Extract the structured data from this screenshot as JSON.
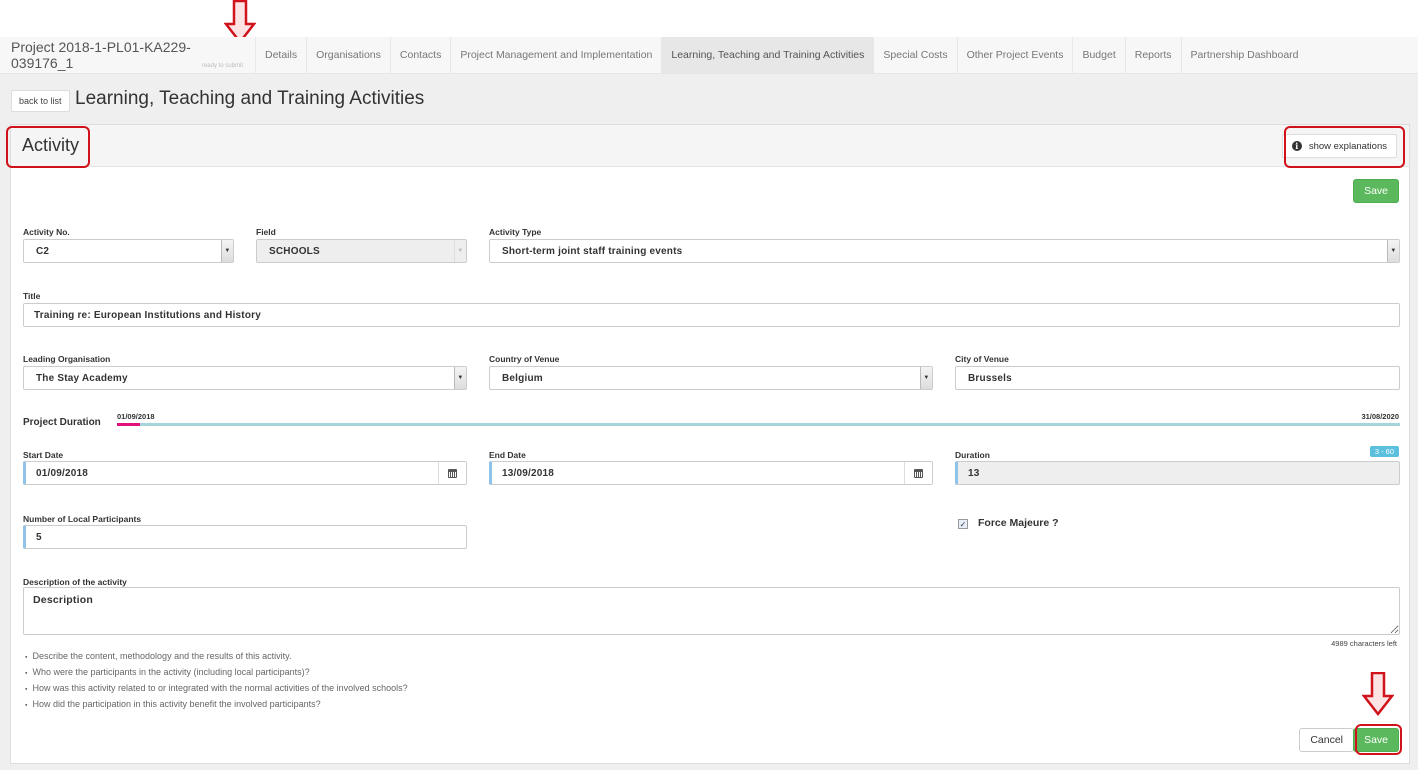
{
  "navbar": {
    "project_title": "Project 2018-1-PL01-KA229-039176_1",
    "project_status": "ready to submit",
    "tabs": [
      {
        "label": "Details",
        "active": false
      },
      {
        "label": "Organisations",
        "active": false
      },
      {
        "label": "Contacts",
        "active": false
      },
      {
        "label": "Project Management and Implementation",
        "active": false
      },
      {
        "label": "Learning, Teaching and Training Activities",
        "active": true
      },
      {
        "label": "Special Costs",
        "active": false
      },
      {
        "label": "Other Project Events",
        "active": false
      },
      {
        "label": "Budget",
        "active": false
      },
      {
        "label": "Reports",
        "active": false
      },
      {
        "label": "Partnership Dashboard",
        "active": false
      }
    ]
  },
  "header": {
    "back_label": "back to list",
    "title": "Learning, Teaching and Training Activities"
  },
  "panel": {
    "title": "Activity",
    "explain_label": "show explanations",
    "save_label": "Save",
    "cancel_label": "Cancel"
  },
  "form": {
    "activity_no": {
      "label": "Activity No.",
      "value": "C2"
    },
    "field": {
      "label": "Field",
      "value": "SCHOOLS"
    },
    "activity_type": {
      "label": "Activity Type",
      "value": "Short-term joint staff training events"
    },
    "title": {
      "label": "Title",
      "value": "Training re: European Institutions and History"
    },
    "leading_org": {
      "label": "Leading Organisation",
      "value": "The Stay Academy"
    },
    "country": {
      "label": "Country of Venue",
      "value": "Belgium"
    },
    "city": {
      "label": "City of Venue",
      "value": "Brussels"
    },
    "project_duration": {
      "label": "Project Duration",
      "start": "01/09/2018",
      "end": "31/08/2020",
      "activity_fraction": 0.018
    },
    "start_date": {
      "label": "Start Date",
      "value": "01/09/2018"
    },
    "end_date": {
      "label": "End Date",
      "value": "13/09/2018"
    },
    "duration": {
      "label": "Duration",
      "value": "13",
      "range_badge": "3 - 60"
    },
    "local_participants": {
      "label": "Number of Local Participants",
      "value": "5"
    },
    "force_majeure": {
      "label": "Force Majeure ?",
      "checked": true
    },
    "description": {
      "label": "Description of the activity",
      "value": "Description",
      "chars_left": "4989 characters left",
      "hints": [
        "Describe the content, methodology and the results of this activity.",
        "Who were the participants in the activity (including local participants)?",
        "How was this activity related to or integrated with the normal activities of the involved schools?",
        "How did the participation in this activity benefit the involved participants?"
      ]
    }
  },
  "colors": {
    "accent_green": "#5cb85c",
    "highlight_red": "#d0121b",
    "duration_fill": "#e0107c",
    "duration_track": "#a8d5dc",
    "badge_blue": "#5bc0de"
  }
}
